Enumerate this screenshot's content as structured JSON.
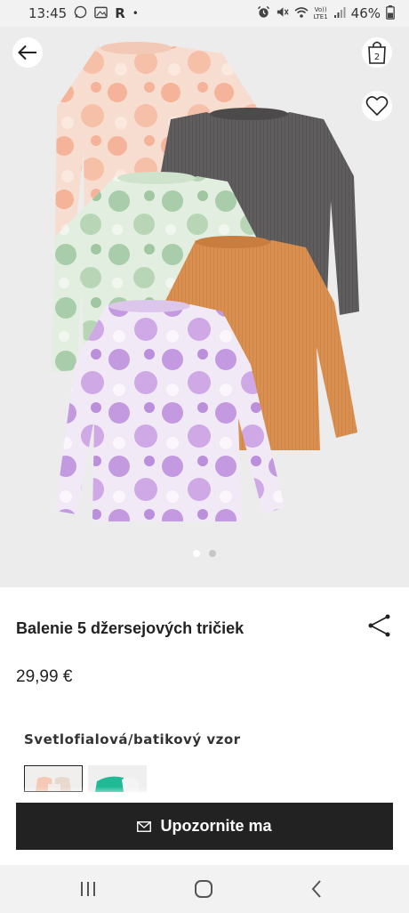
{
  "status_bar": {
    "time": "13:45",
    "carrier_badge": "R",
    "bullet": "•",
    "volte_top": "Vo))",
    "volte_bottom": "LTE1",
    "battery": "46%",
    "icons": [
      "whatsapp-icon",
      "gallery-icon",
      "alarm-icon",
      "mute-icon",
      "wifi-icon",
      "signal-icon",
      "battery-icon"
    ]
  },
  "hero": {
    "icons": {
      "back": "arrow-left-icon",
      "bag": "shopping-bag-icon",
      "wishlist": "heart-icon"
    },
    "bag_count": "2",
    "carousel_total": 2,
    "carousel_active": 0
  },
  "product": {
    "title": "Balenie 5 džersejových tričiek",
    "price": "29,99 €",
    "color_label": "Svetlofialová/batikový vzor",
    "swatches": [
      {
        "name": "light-purple-tie-dye",
        "selected": true
      },
      {
        "name": "green",
        "selected": false
      }
    ]
  },
  "cta": {
    "label": "Upozornite ma",
    "icon": "mail-icon"
  },
  "colors": {
    "cta_bg": "#222222",
    "hero_bg": "#ececec",
    "peach": "#f5b39a",
    "grey": "#5f5d5e",
    "mint": "#a9cdaa",
    "orange": "#d98f4f",
    "lilac": "#c39ae0",
    "teal": "#1fb996"
  },
  "navbar": {
    "icons": [
      "recent-apps-icon",
      "home-icon",
      "back-icon"
    ]
  }
}
